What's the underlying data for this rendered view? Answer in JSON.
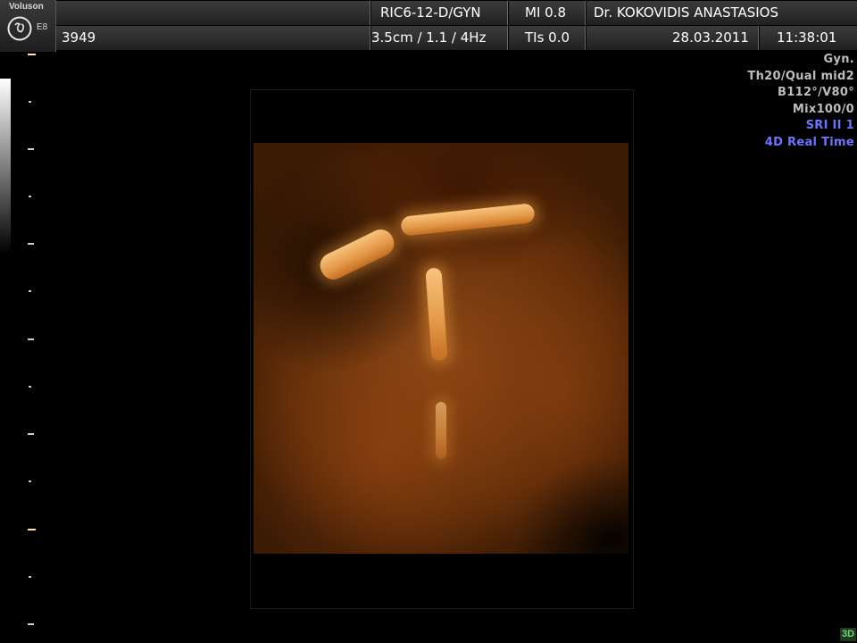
{
  "header": {
    "brand": "Voluson",
    "model": "E8",
    "logo": "ge-logo",
    "patient_id": "3949",
    "probe": "RIC6-12-D/GYN",
    "depth_freq": "3.5cm / 1.1 /  4Hz",
    "mi": "MI  0.8",
    "tis": "TIs  0.0",
    "doctor": "Dr. KOKOVIDIS ANASTASIOS",
    "date": "28.03.2011",
    "time": "11:38:01"
  },
  "info_panel": {
    "lines": [
      "Gyn.",
      "Th20/Qual mid2",
      "B112°/V80°",
      "Mix100/0"
    ],
    "mode_lines": [
      "SRI II 1",
      "4D Real Time"
    ]
  },
  "badge": "3D",
  "colors": {
    "background": "#000000",
    "header_cell": "#2e2e2e",
    "info_text": "#bdbdbd",
    "mode_text": "#6c74ff",
    "sepia_render": "#8a4716",
    "badge_text": "#6fd66f"
  }
}
